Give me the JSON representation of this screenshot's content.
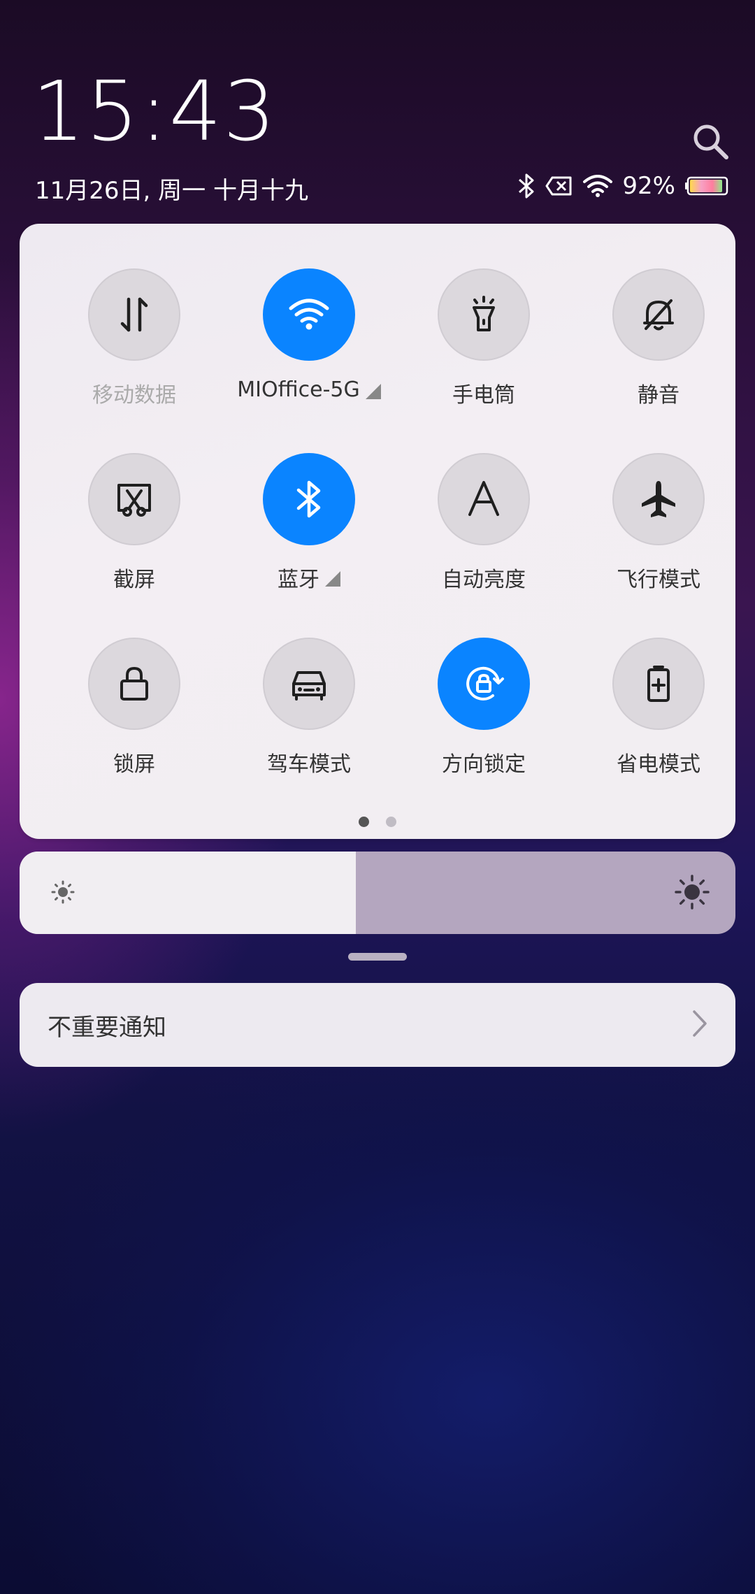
{
  "status": {
    "time": "15:43",
    "date": "11月26日, 周一 十月十九",
    "battery_percent": "92%",
    "battery_level": 0.92,
    "icons": [
      "bluetooth-icon",
      "no-sim-icon",
      "wifi-icon",
      "battery-icon"
    ]
  },
  "quick_settings": {
    "page_count": 2,
    "active_page": 0,
    "tiles": [
      {
        "label": "移动数据",
        "icon": "mobile-data-icon",
        "on": false,
        "dim": true
      },
      {
        "label": "MIOffice-5G",
        "icon": "wifi-icon",
        "on": true,
        "expand": true
      },
      {
        "label": "手电筒",
        "icon": "flashlight-icon",
        "on": false
      },
      {
        "label": "静音",
        "icon": "mute-bell-icon",
        "on": false
      },
      {
        "label": "截屏",
        "icon": "screenshot-icon",
        "on": false
      },
      {
        "label": "蓝牙",
        "icon": "bluetooth-icon",
        "on": true,
        "expand": true
      },
      {
        "label": "自动亮度",
        "icon": "auto-brightness-icon",
        "on": false
      },
      {
        "label": "飞行模式",
        "icon": "airplane-icon",
        "on": false
      },
      {
        "label": "锁屏",
        "icon": "lock-icon",
        "on": false
      },
      {
        "label": "驾车模式",
        "icon": "car-icon",
        "on": false
      },
      {
        "label": "方向锁定",
        "icon": "rotation-lock-icon",
        "on": true
      },
      {
        "label": "省电模式",
        "icon": "battery-saver-icon",
        "on": false
      }
    ]
  },
  "brightness": {
    "level": 0.47
  },
  "notifications": {
    "unimportant_label": "不重要通知"
  },
  "colors": {
    "accent": "#0a84ff",
    "tile_off": "#dcd8dd",
    "panel": "#f1eef2"
  }
}
